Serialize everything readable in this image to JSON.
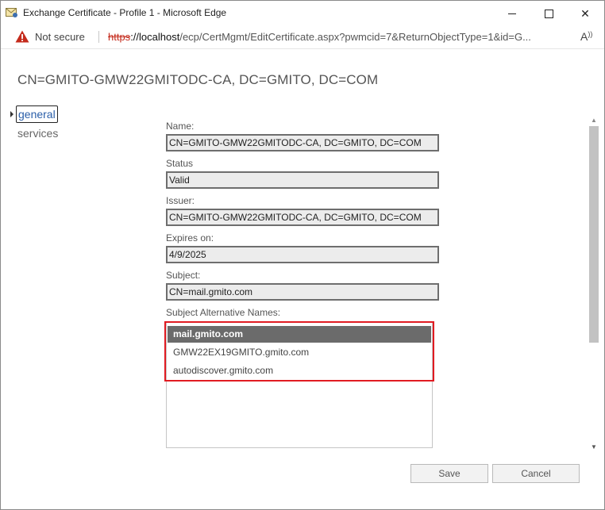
{
  "window": {
    "title": "Exchange Certificate - Profile 1 - Microsoft Edge",
    "controls": {
      "minimize": "minimize",
      "maximize": "maximize",
      "close": "✕"
    }
  },
  "address_bar": {
    "security_label": "Not secure",
    "url_scheme": "https",
    "url_rest_host": "://localhost",
    "url_path": "/ecp/CertMgmt/EditCertificate.aspx?pwmcid=7&ReturnObjectType=1&id=G...",
    "read_aloud_glyph": "A&#x1F50A;"
  },
  "page": {
    "heading": "CN=GMITO-GMW22GMITODC-CA, DC=GMITO, DC=COM"
  },
  "nav": {
    "items": [
      {
        "label": "general",
        "selected": true
      },
      {
        "label": "services",
        "selected": false
      }
    ]
  },
  "form": {
    "name": {
      "label": "Name:",
      "value": "CN=GMITO-GMW22GMITODC-CA, DC=GMITO, DC=COM"
    },
    "status": {
      "label": "Status",
      "value": "Valid"
    },
    "issuer": {
      "label": "Issuer:",
      "value": "CN=GMITO-GMW22GMITODC-CA, DC=GMITO, DC=COM"
    },
    "expires": {
      "label": "Expires on:",
      "value": "4/9/2025"
    },
    "subject": {
      "label": "Subject:",
      "value": "CN=mail.gmito.com"
    },
    "san": {
      "label": "Subject Alternative Names:",
      "items": [
        "mail.gmito.com",
        "GMW22EX19GMITO.gmito.com",
        "autodiscover.gmito.com"
      ],
      "selected_index": 0
    }
  },
  "buttons": {
    "save": "Save",
    "cancel": "Cancel"
  },
  "colors": {
    "highlight_border": "#e11b22",
    "selected_row": "#6b6b6b",
    "link": "#2a5ea8",
    "warning": "#c42b1c"
  }
}
